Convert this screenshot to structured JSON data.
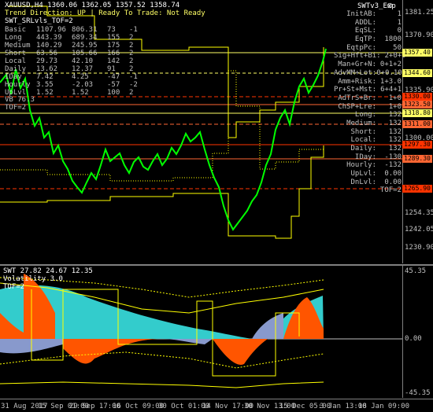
{
  "header": {
    "symbol_line": "XAUUSD,H4  1360.06 1362.05 1357.52 1358.74",
    "trend_label": "Trend Direction:  UP  |  Ready To Trade:  Not Ready",
    "indicator_name": "SWT_SRLvls_TOF=2",
    "ea_name": "SWTv3_Exp",
    "smiley": "☺"
  },
  "stats_table": [
    {
      "label": "Basic",
      "a": "1107.96",
      "b": "806.31",
      "c": "73",
      "d": "-1"
    },
    {
      "label": "Long",
      "a": "443.39",
      "b": "689.34",
      "c": "155",
      "d": "2"
    },
    {
      "label": "Medium",
      "a": "140.29",
      "b": "245.95",
      "c": "175",
      "d": "2"
    },
    {
      "label": "Short",
      "a": "63.56",
      "b": "105.66",
      "c": "166",
      "d": "2"
    },
    {
      "label": "Local",
      "a": "29.73",
      "b": "42.10",
      "c": "142",
      "d": "2"
    },
    {
      "label": "Daily",
      "a": "13.62",
      "b": "12.37",
      "c": "91",
      "d": "2"
    },
    {
      "label": "IDay",
      "a": "7.42",
      "b": "4.25",
      "c": "-47",
      "d": "-1"
    },
    {
      "label": "Hourly",
      "a": "3.55",
      "b": "-2.03",
      "c": "-57",
      "d": "-2"
    },
    {
      "label": "UpLvl",
      "a": "1.52",
      "b": "1.52",
      "c": "100",
      "d": "2"
    }
  ],
  "left_extra": [
    "VB 76.3",
    "TOF=2"
  ],
  "right_panel": [
    {
      "label": "InitAB:",
      "value": "1"
    },
    {
      "label": "ADDL:",
      "value": "1"
    },
    {
      "label": "EqSL:",
      "value": "0"
    },
    {
      "label": "EqTP:",
      "value": "1800"
    },
    {
      "label": "EqtpPc:",
      "value": "50"
    },
    {
      "label": "Sig+Hft+Bi:",
      "value": "2+0+0"
    },
    {
      "label": "Man+Gr+N:",
      "value": "0+1+2"
    },
    {
      "label": "AdvMM+Lot:",
      "value": "0+0.10"
    },
    {
      "label": "Amm+Risk:",
      "value": "1+3.0"
    },
    {
      "label": "Pr+St+Mst:",
      "value": "6+4+1"
    },
    {
      "label": "AdTrS+Br:",
      "value": "1+0"
    },
    {
      "label": "ChSP+Lre:",
      "value": "1+0"
    },
    {
      "label": "Long:",
      "value": "132"
    },
    {
      "label": "Medium:",
      "value": "132"
    },
    {
      "label": "Short:",
      "value": "132"
    },
    {
      "label": "Local:",
      "value": "132"
    },
    {
      "label": "Daily:",
      "value": "132"
    },
    {
      "label": "IDay:",
      "value": "-130"
    },
    {
      "label": "Hourly:",
      "value": "-132"
    },
    {
      "label": "UpLvl:",
      "value": "0.00"
    },
    {
      "label": "DnLvl:",
      "value": "0.00"
    },
    {
      "label": "",
      "value": "TOF=2"
    }
  ],
  "price_axis": [
    "1381.25",
    "1370.90",
    "1357.40",
    "1346.00",
    "1335.90",
    "1324.80",
    "1318.80",
    "1311.00",
    "1300.00",
    "1297.30",
    "1289.30",
    "1265.00",
    "1254.35",
    "1242.05",
    "1230.90",
    "1219.35"
  ],
  "price_tags": [
    {
      "text": "1357.40",
      "color": "#ffff66"
    },
    {
      "text": "1344.60",
      "color": "#ffff66"
    },
    {
      "text": "1330.00",
      "color": "#ff3300"
    },
    {
      "text": "1323.50",
      "color": "#ff6633"
    },
    {
      "text": "1318.80",
      "color": "#ffff66"
    },
    {
      "text": "1311.00",
      "color": "#ff6633"
    },
    {
      "text": "1297.30",
      "color": "#ff3300"
    },
    {
      "text": "1289.30",
      "color": "#ff6633"
    },
    {
      "text": "1265.90",
      "color": "#ff3300"
    }
  ],
  "sub_window": {
    "title": "SWT 27.82 24.67 12.35",
    "subtitle": "Volatility 3.0",
    "subtitle2": "TOF=2",
    "axis_top": "45.35",
    "axis_zero": "0.00",
    "axis_bottom": "-45.35"
  },
  "time_axis": [
    "31 Aug 2017",
    "15 Sep 01:00",
    "29 Sep 17:00",
    "16 Oct 09:00",
    "30 Oct 01:00",
    "14 Nov 17:00",
    "30 Nov 13:00",
    "15 Dec 05:00",
    "3 Jan 13:00",
    "18 Jan 09:00"
  ],
  "colors": {
    "up_candle": "#00ff00",
    "support": "#ffff00",
    "resist": "#ff3300",
    "cyan_fill": "#33cccc",
    "orange_fill": "#ff5500",
    "blue_fill": "#8899cc"
  }
}
